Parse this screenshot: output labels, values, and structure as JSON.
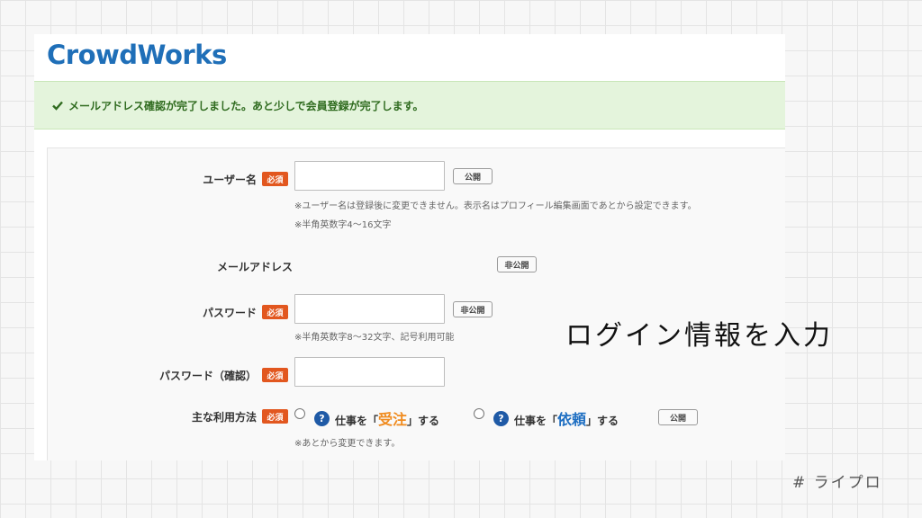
{
  "brand": {
    "logo_text": "CrowdWorks",
    "color": "#1f6fb8"
  },
  "notice": {
    "icon": "check-icon",
    "text": "メールアドレス確認が完了しました。あと少しで会員登録が完了します。",
    "color": "#2f6b1f"
  },
  "form": {
    "required_label": "必須",
    "username": {
      "label": "ユーザー名",
      "value": "",
      "visibility": "公開",
      "note1": "※ユーザー名は登録後に変更できません。表示名はプロフィール編集画面であとから設定できます。",
      "note2": "※半角英数字4〜16文字"
    },
    "email": {
      "label": "メールアドレス",
      "visibility": "非公開"
    },
    "password": {
      "label": "パスワード",
      "value": "",
      "visibility": "非公開",
      "note": "※半角英数字8〜32文字、記号利用可能"
    },
    "password_confirm": {
      "label": "パスワード（確認）",
      "value": ""
    },
    "usage": {
      "label": "主な利用方法",
      "option1": {
        "prefix": "仕事を「",
        "keyword": "受注",
        "suffix": "」する",
        "selected": false
      },
      "option2": {
        "prefix": "仕事を「",
        "keyword": "依頼",
        "suffix": "」する",
        "selected": false
      },
      "help_glyph": "?",
      "visibility": "公開",
      "note": "※あとから変更できます。"
    }
  },
  "overlay": {
    "annotation": "ログイン情報を入力",
    "hashtag": "# ライプロ"
  },
  "colors": {
    "required_badge": "#e2571f",
    "orange_keyword": "#f08b1e",
    "blue_keyword": "#1f6fc2",
    "help_icon": "#1f5aa6"
  }
}
